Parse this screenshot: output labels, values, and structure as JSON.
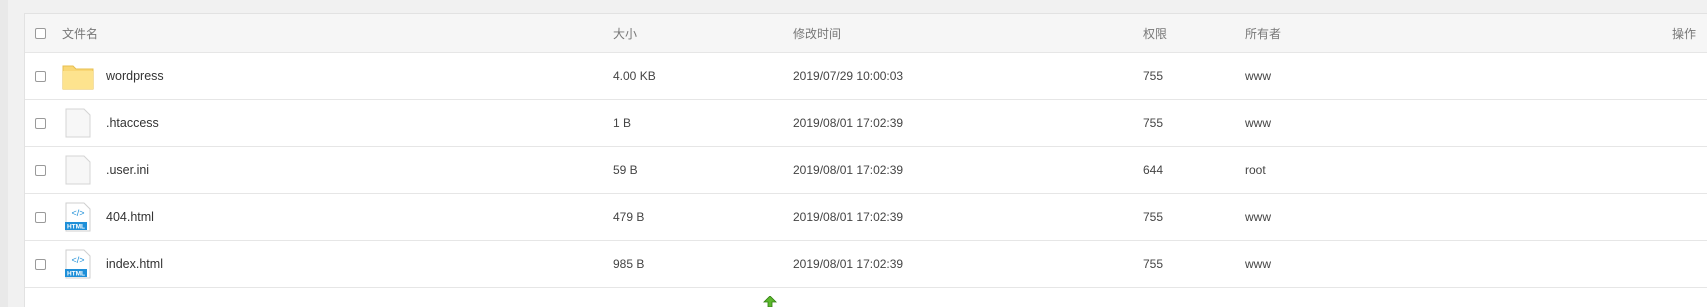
{
  "header": {
    "name": "文件名",
    "size": "大小",
    "modified": "修改时间",
    "permissions": "权限",
    "owner": "所有者",
    "operations": "操作"
  },
  "files": [
    {
      "name": "wordpress",
      "icon": "folder-icon",
      "size": "4.00 KB",
      "modified": "2019/07/29 10:00:03",
      "perm": "755",
      "owner": "www"
    },
    {
      "name": ".htaccess",
      "icon": "file-icon",
      "size": "1 B",
      "modified": "2019/08/01 17:02:39",
      "perm": "755",
      "owner": "www"
    },
    {
      "name": ".user.ini",
      "icon": "file-icon",
      "size": "59 B",
      "modified": "2019/08/01 17:02:39",
      "perm": "644",
      "owner": "root"
    },
    {
      "name": "404.html",
      "icon": "html-file-icon",
      "size": "479 B",
      "modified": "2019/08/01 17:02:39",
      "perm": "755",
      "owner": "www"
    },
    {
      "name": "index.html",
      "icon": "html-file-icon",
      "size": "985 B",
      "modified": "2019/08/01 17:02:39",
      "perm": "755",
      "owner": "www"
    }
  ],
  "html_badge": "HTML",
  "html_symbol": "</>",
  "colors": {
    "folder": "#f9d776",
    "html_icon": "#1e8fd8",
    "border": "#e6e6e6"
  }
}
